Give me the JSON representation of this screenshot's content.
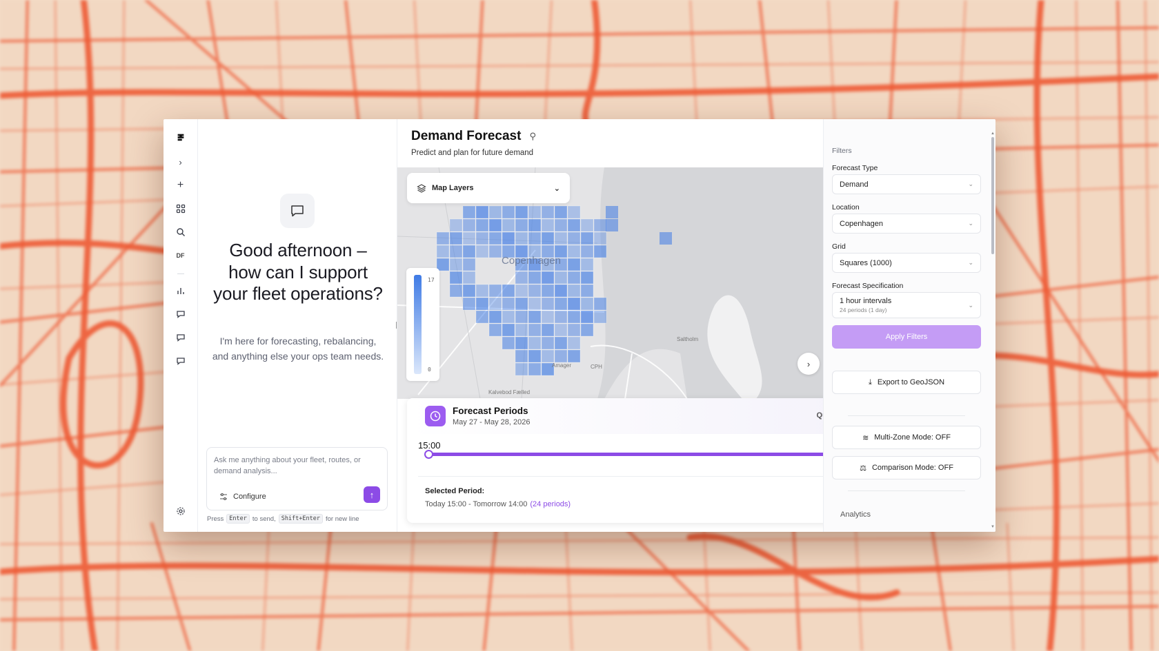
{
  "rail": {
    "items": [
      "logo",
      "expand",
      "new",
      "apps",
      "search",
      "DF",
      "chart",
      "chat1",
      "chat2",
      "chat3"
    ],
    "df_label": "DF"
  },
  "chat": {
    "greeting": "Good afternoon – how can I support your fleet operations?",
    "subtitle": "I'm here for forecasting, rebalancing, and anything else your ops team needs.",
    "placeholder": "Ask me anything about your fleet, routes, or demand analysis...",
    "configure_label": "Configure",
    "hint_press": "Press",
    "hint_enter": "Enter",
    "hint_to_send": "to send,",
    "hint_shift": "Shift+Enter",
    "hint_newline": "for new line"
  },
  "main": {
    "title": "Demand Forecast",
    "description": "Predict and plan for future demand",
    "map_layers_label": "Map Layers",
    "legend_max": "17",
    "legend_min": "0",
    "city_label": "Copenhagen",
    "label_amager": "Amager",
    "label_cph": "CPH",
    "label_saltholm": "Saltholm",
    "label_kalvebod": "Kalvebod Fælled",
    "accent": "#8c4be6",
    "heat_color": "#3f7be5"
  },
  "periods": {
    "title": "Forecast Periods",
    "range": "May 27 - May 28, 2026",
    "quick": "Quic",
    "time": "15:00",
    "selected_label": "Selected Period:",
    "selected_value": "Today 15:00 - Tomorrow 14:00",
    "selected_count": "(24 periods)",
    "slider_position": 0
  },
  "filters": {
    "section": "Filters",
    "forecast_type_label": "Forecast Type",
    "forecast_type_value": "Demand",
    "location_label": "Location",
    "location_value": "Copenhagen",
    "grid_label": "Grid",
    "grid_value": "Squares (1000)",
    "spec_label": "Forecast Specification",
    "spec_value": "1 hour intervals",
    "spec_sub": "24 periods (1 day)",
    "apply_label": "Apply Filters",
    "export_label": "Export to GeoJSON",
    "multizone_label": "Multi-Zone Mode: OFF",
    "comparison_label": "Comparison Mode: OFF",
    "analytics_label": "Analytics",
    "apply_color": "#c49cf5"
  }
}
